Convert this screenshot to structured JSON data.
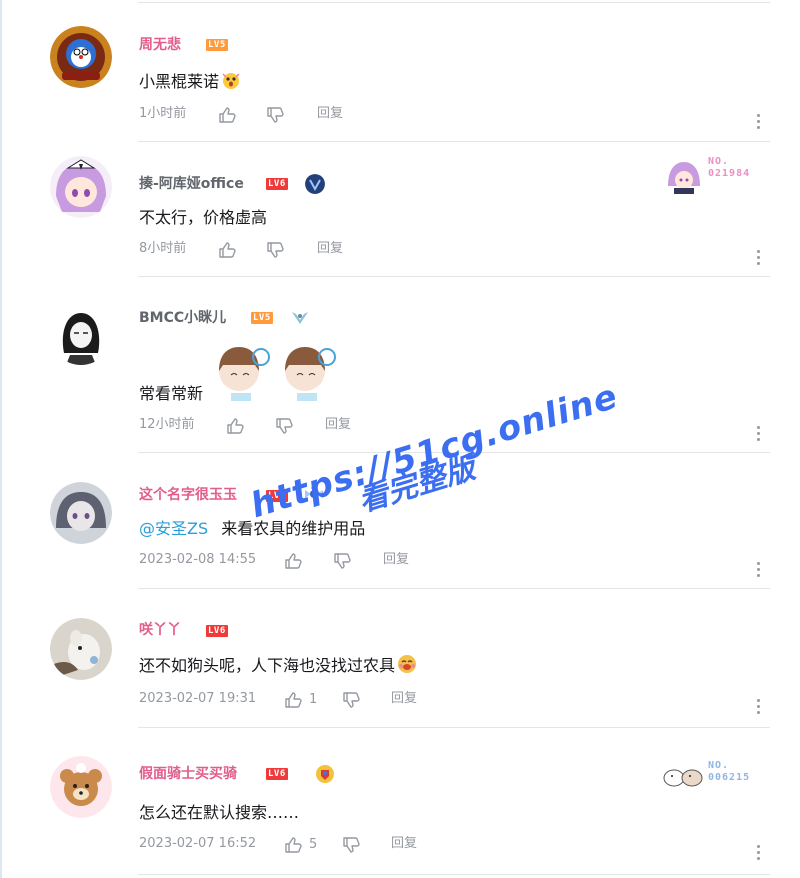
{
  "comments": [
    {
      "username": "周无悲",
      "level": "LV5",
      "content": "小黑棍莱诺",
      "time": "1小时前",
      "reply_label": "回复",
      "like_count": ""
    },
    {
      "username": "揍-阿库娅office",
      "level": "LV6",
      "content": "不太行，价格虚高",
      "time": "8小时前",
      "reply_label": "回复",
      "like_count": "",
      "fan_label": "NO.",
      "fan_number": "021984"
    },
    {
      "username": "BMCC小眯儿",
      "level": "LV5",
      "content": "常看常新",
      "time": "12小时前",
      "reply_label": "回复",
      "like_count": ""
    },
    {
      "username": "这个名字很玉玉",
      "level": "LV6",
      "mention": "@安圣ZS",
      "content": "来看农具的维护用品",
      "time": "2023-02-08 14:55",
      "reply_label": "回复",
      "like_count": ""
    },
    {
      "username": "咲丫丫",
      "level": "LV6",
      "content": "还不如狗头呢，人下海也没找过农具",
      "time": "2023-02-07 19:31",
      "reply_label": "回复",
      "like_count": "1"
    },
    {
      "username": "假面骑士买买骑",
      "level": "LV6",
      "content": "怎么还在默认搜索……",
      "time": "2023-02-07 16:52",
      "reply_label": "回复",
      "like_count": "5",
      "fan_label": "NO.",
      "fan_number": "006215"
    }
  ],
  "watermark": {
    "line1": "https://51cg.online",
    "line2": "看完整版"
  },
  "colors": {
    "vip_name": "#e25c8c",
    "normal_name": "#61666d",
    "meta_text": "#9499a0",
    "mention": "#2a9ed8",
    "watermark": "#3b6ef0"
  },
  "icons": [
    "like-icon",
    "dislike-icon",
    "more-icon",
    "level-badge"
  ]
}
